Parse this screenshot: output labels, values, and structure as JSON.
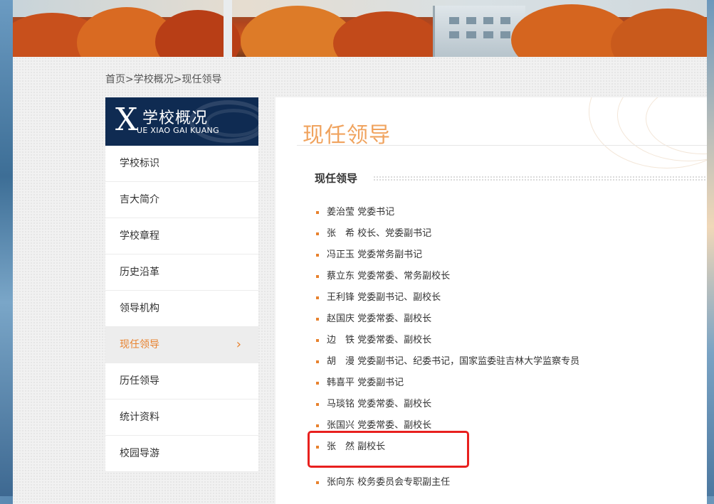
{
  "breadcrumb": {
    "home": "首页",
    "sep1": ">",
    "section": "学校概况",
    "sep2": ">",
    "current": "现任领导"
  },
  "sidebar": {
    "header": {
      "initial": "X",
      "title": "学校概况",
      "pinyin": "UE XIAO GAI KUANG"
    },
    "items": [
      {
        "label": "学校标识"
      },
      {
        "label": "吉大简介"
      },
      {
        "label": "学校章程"
      },
      {
        "label": "历史沿革"
      },
      {
        "label": "领导机构"
      },
      {
        "label": "现任领导",
        "active": true
      },
      {
        "label": "历任领导"
      },
      {
        "label": "统计资料"
      },
      {
        "label": "校园导游"
      }
    ],
    "active_chevron": "›"
  },
  "content": {
    "title": "现任领导",
    "section_title": "现任领导",
    "leaders": [
      {
        "text": "姜治莹 党委书记"
      },
      {
        "text": "张　希 校长、党委副书记"
      },
      {
        "text": "冯正玉 党委常务副书记"
      },
      {
        "text": "蔡立东 党委常委、常务副校长"
      },
      {
        "text": "王利锋 党委副书记、副校长"
      },
      {
        "text": "赵国庆 党委常委、副校长"
      },
      {
        "text": "边　铁 党委常委、副校长"
      },
      {
        "text": "胡　漫 党委副书记、纪委书记，国家监委驻吉林大学监察专员"
      },
      {
        "text": "韩喜平 党委副书记"
      },
      {
        "text": "马琰铭 党委常委、副校长"
      },
      {
        "text": "张国兴 党委常委、副校长"
      },
      {
        "text": "张　然 副校长"
      },
      {
        "text": "张向东 校务委员会专职副主任"
      }
    ]
  },
  "colors": {
    "accent": "#e8822e",
    "title": "#f0a35e",
    "sidebar_header": "#0f2b52",
    "highlight_box": "#e8201e"
  }
}
